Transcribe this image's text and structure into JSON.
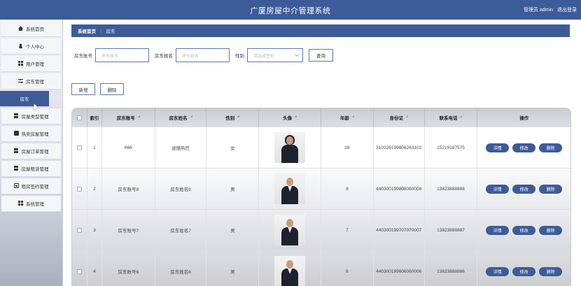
{
  "header": {
    "title": "广厦房屋中介管理系统",
    "user_label": "管理员 admin",
    "logout_label": "退出登录"
  },
  "sidebar": {
    "items": [
      {
        "label": "系统首页",
        "icon": "home-icon"
      },
      {
        "label": "个人中心",
        "icon": "user-icon"
      },
      {
        "label": "用户管理",
        "icon": "grid-icon"
      },
      {
        "label": "房东管理",
        "icon": "sliders-icon"
      },
      {
        "label": "房东",
        "icon": ""
      },
      {
        "label": "房屋类型管理",
        "icon": "grid-icon"
      },
      {
        "label": "热卖房屋管理",
        "icon": "box-icon"
      },
      {
        "label": "房屋订单管理",
        "icon": "grid-icon"
      },
      {
        "label": "房屋租赁管理",
        "icon": "grid-icon"
      },
      {
        "label": "租房签约管理",
        "icon": "doc-icon"
      },
      {
        "label": "系统管理",
        "icon": "grid-icon"
      }
    ],
    "active_index": 4
  },
  "breadcrumb": {
    "home": "系统首页",
    "separator": "⋮",
    "current": "房东"
  },
  "search": {
    "account_label": "房东账号",
    "account_placeholder": "房东账号",
    "name_label": "房东姓名",
    "name_placeholder": "房东姓名",
    "gender_label": "性别",
    "gender_placeholder": "请选择性别",
    "query_label": "查询"
  },
  "actions": {
    "add_label": "新增",
    "delete_label": "删除"
  },
  "table": {
    "columns": [
      "索引",
      "房东账号",
      "房东姓名",
      "性别",
      "头像",
      "年龄",
      "身份证",
      "联系电话",
      "操作"
    ],
    "rows": [
      {
        "index": "1",
        "account": "666",
        "name": "迪丽热巴",
        "gender": "女",
        "age": "28",
        "id_card": "310226199806263102",
        "phone": "15219187575"
      },
      {
        "index": "2",
        "account": "房东账号8",
        "name": "房东姓名8",
        "gender": "男",
        "age": "8",
        "id_card": "440300199808080008",
        "phone": "13823888888"
      },
      {
        "index": "3",
        "account": "房东账号7",
        "name": "房东姓名7",
        "gender": "男",
        "age": "7",
        "id_card": "440300199707070007",
        "phone": "13823888887"
      },
      {
        "index": "4",
        "account": "房东账号6",
        "name": "房东姓名6",
        "gender": "男",
        "age": "6",
        "id_card": "440300199606060006",
        "phone": "13823888886"
      }
    ],
    "row_actions": {
      "detail": "详情",
      "edit": "修改",
      "delete": "删除"
    }
  },
  "colors": {
    "primary": "#3d5b98",
    "header_bg": "#3d5b98"
  }
}
